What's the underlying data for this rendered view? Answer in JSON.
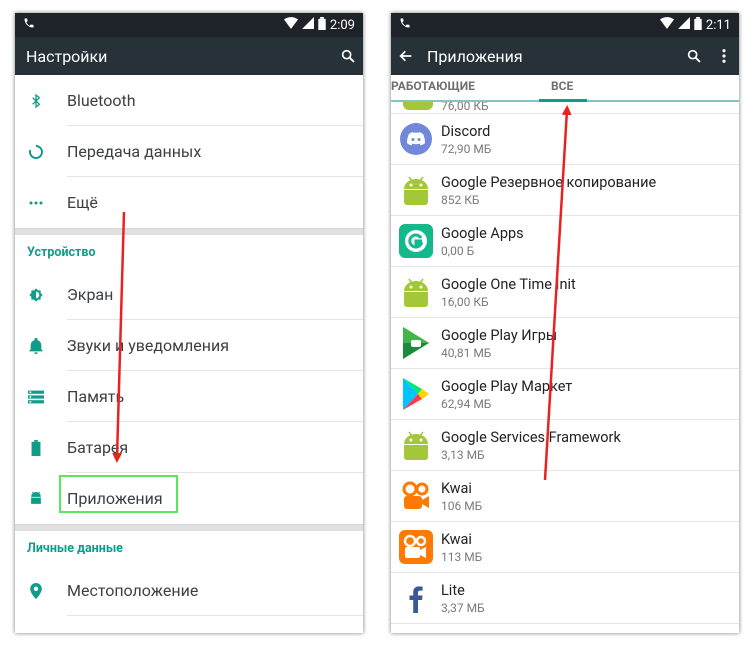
{
  "screen1": {
    "status_time": "2:09",
    "title": "Настройки",
    "items_top": [
      {
        "label": "Bluetooth",
        "icon": "bluetooth-icon"
      },
      {
        "label": "Передача данных",
        "icon": "data-usage-icon"
      },
      {
        "label": "Ещё",
        "icon": "more-dots-icon"
      }
    ],
    "section_device": "Устройство",
    "items_device": [
      {
        "label": "Экран",
        "icon": "brightness-icon"
      },
      {
        "label": "Звуки и уведомления",
        "icon": "bell-icon"
      },
      {
        "label": "Память",
        "icon": "storage-icon"
      },
      {
        "label": "Батарея",
        "icon": "battery-icon"
      },
      {
        "label": "Приложения",
        "icon": "android-icon"
      }
    ],
    "section_personal": "Личные данные",
    "items_personal": [
      {
        "label": "Местоположение",
        "icon": "location-pin-icon"
      }
    ]
  },
  "screen2": {
    "status_time": "2:11",
    "title": "Приложения",
    "tabs": [
      "РАБОТАЮЩИЕ",
      "ВСЕ"
    ],
    "active_tab": "ВСЕ",
    "partial_size": "76,00 КБ",
    "apps": [
      {
        "name": "Discord",
        "size": "72,90 МБ",
        "icon": "discord-icon"
      },
      {
        "name": "Google Резервное копирование",
        "size": "852 КБ",
        "icon": "android-icon"
      },
      {
        "name": "Google Apps",
        "size": "0,00 Б",
        "icon": "google-apps-icon"
      },
      {
        "name": "Google One Time Init",
        "size": "16,00 КБ",
        "icon": "android-icon"
      },
      {
        "name": "Google Play Игры",
        "size": "40,81 МБ",
        "icon": "play-games-icon"
      },
      {
        "name": "Google Play Маркет",
        "size": "62,94 МБ",
        "icon": "play-store-icon"
      },
      {
        "name": "Google Services Framework",
        "size": "3,13 МБ",
        "icon": "android-icon"
      },
      {
        "name": "Kwai",
        "size": "106 МБ",
        "icon": "kwai-icon"
      },
      {
        "name": "Kwai",
        "size": "113 МБ",
        "icon": "kwai-icon"
      },
      {
        "name": "Lite",
        "size": "3,37 МБ",
        "icon": "facebook-icon"
      }
    ]
  },
  "colors": {
    "accent": "#0f9d8a",
    "toolbar": "#263238",
    "arrow": "#e8231f",
    "highlight": "#5ce65c"
  }
}
